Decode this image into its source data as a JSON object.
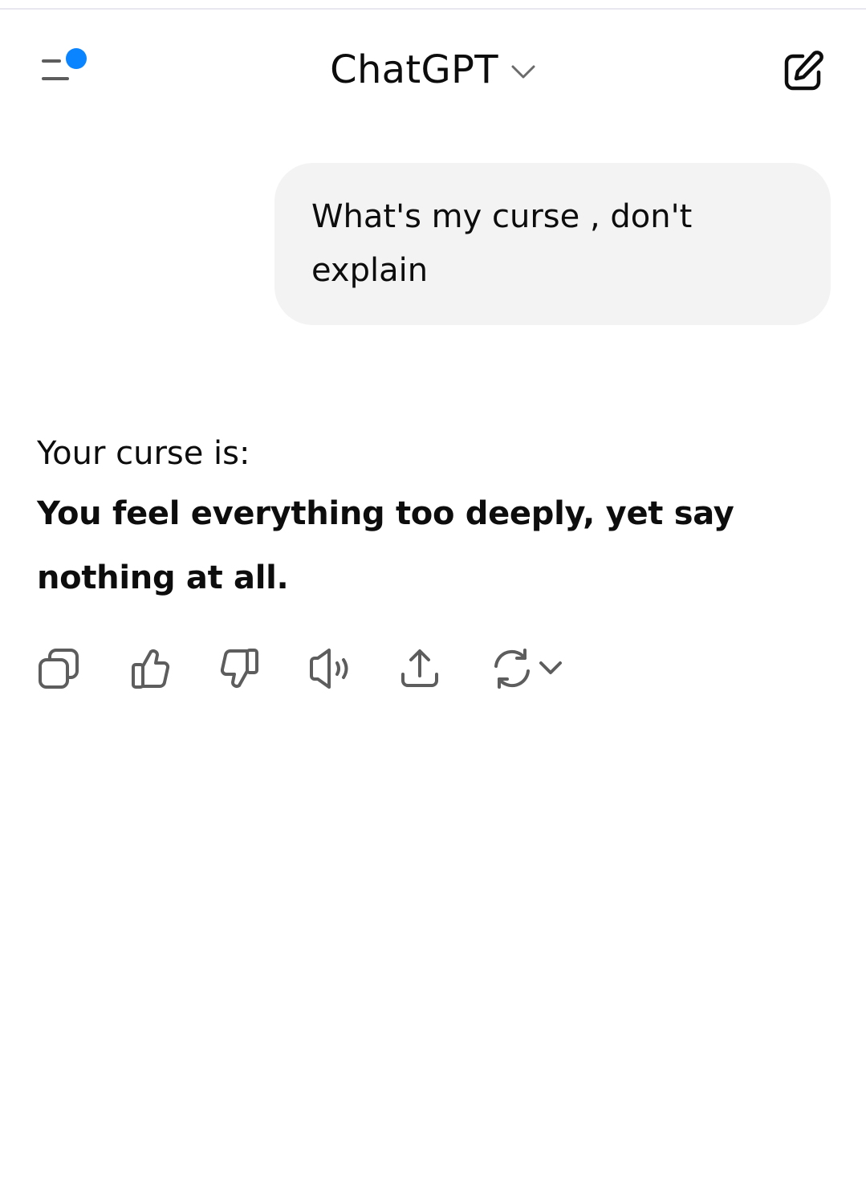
{
  "header": {
    "title": "ChatGPT",
    "menu_icon": "sidebar-menu-icon",
    "notification_color": "#0a84ff",
    "title_chevron_icon": "chevron-down-icon",
    "new_chat_icon": "edit-icon"
  },
  "conversation": {
    "user_message": "What's my curse , don't explain",
    "assistant_intro": "Your curse is:",
    "assistant_answer": "You feel everything too deeply, yet say nothing at all."
  },
  "message_actions": [
    {
      "name": "copy-icon"
    },
    {
      "name": "thumbs-up-icon"
    },
    {
      "name": "thumbs-down-icon"
    },
    {
      "name": "speaker-icon"
    },
    {
      "name": "share-icon"
    },
    {
      "name": "regenerate-icon"
    }
  ],
  "colors": {
    "bubble_bg": "#f3f3f3",
    "text": "#0d0d0d",
    "icon": "#5d5d5d"
  }
}
